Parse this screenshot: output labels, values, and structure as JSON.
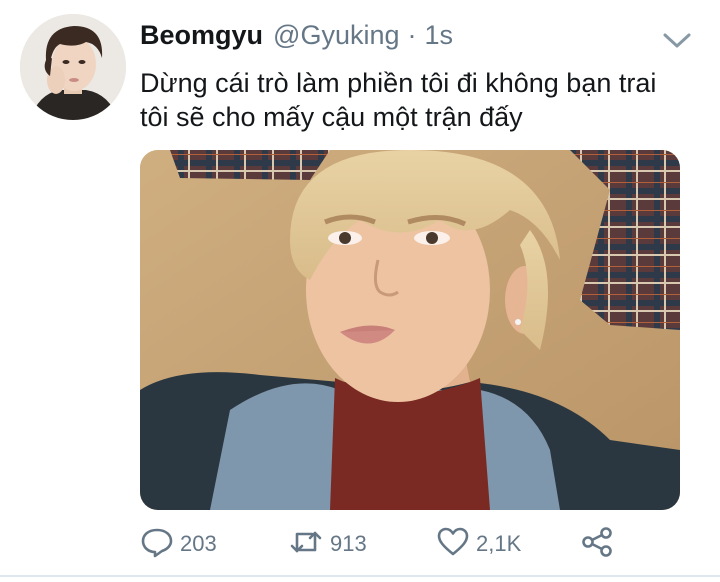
{
  "tweet": {
    "display_name": "Beomgyu",
    "handle": "@Gyuking",
    "separator": "·",
    "time": "1s",
    "text_lines": [
      "Dừng cái trò làm phiền tôi đi không bạn trai",
      "tôi sẽ cho mấy cậu một trận đấy"
    ]
  },
  "actions": {
    "replies": "203",
    "retweets": "913",
    "likes": "2,1K"
  },
  "icons": {
    "menu": "chevron-down-icon",
    "reply": "speech-bubble-icon",
    "retweet": "retweet-arrows-icon",
    "like": "heart-icon",
    "share": "share-nodes-icon"
  },
  "colors": {
    "text": "#14171a",
    "secondary": "#657786"
  }
}
